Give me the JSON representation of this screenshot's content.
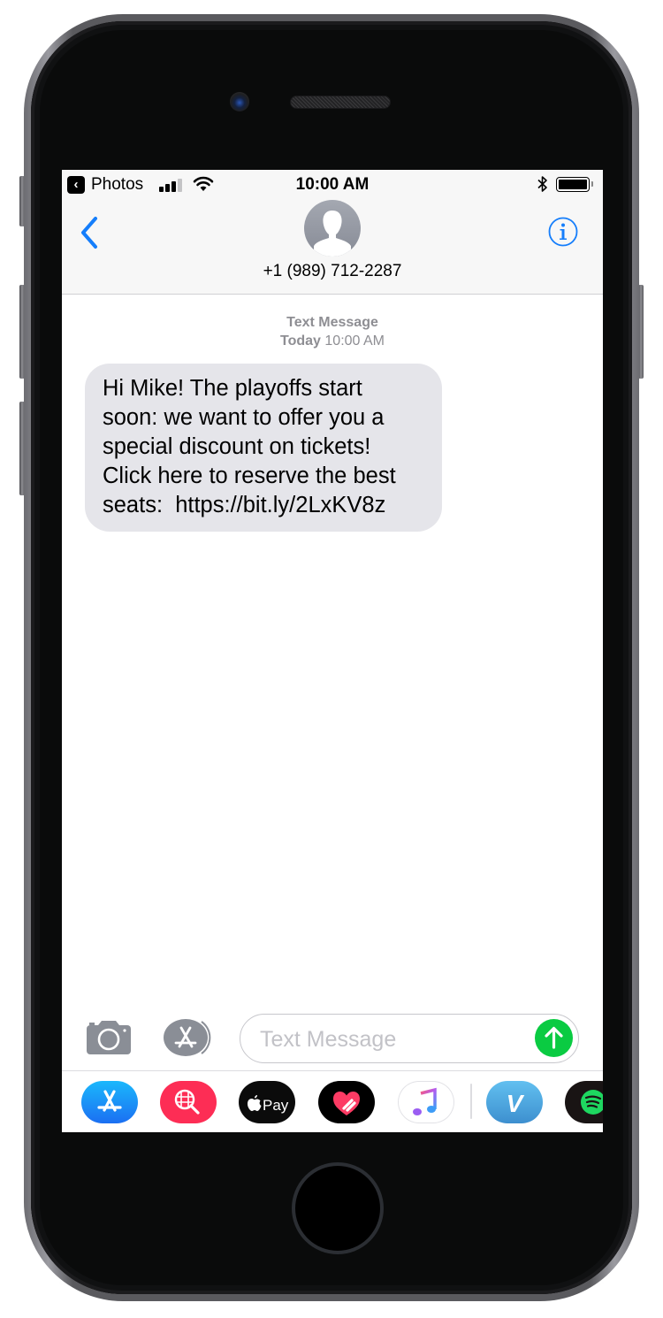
{
  "status_bar": {
    "back_app": "Photos",
    "time": "10:00 AM",
    "signal_bars": 3,
    "signal_max": 4,
    "battery_level": 1.0
  },
  "header": {
    "contact": "+1 (989) 712-2287",
    "back_icon": "chevron-left-icon",
    "info_icon": "info-icon"
  },
  "conversation": {
    "meta_type": "Text Message",
    "meta_day": "Today",
    "meta_time": "10:00 AM",
    "messages": [
      {
        "direction": "incoming",
        "lines": [
          "Hi Mike! The playoffs start",
          "soon: we want to offer you a",
          "special discount on tickets!",
          "Click here to reserve the best",
          "seats:  https://bit.ly/2LxKV8z"
        ]
      }
    ]
  },
  "composer": {
    "placeholder": "Text Message",
    "value": ""
  },
  "app_drawer": {
    "apps": [
      {
        "name": "App Store",
        "icon": "app-store-icon",
        "color": "#1b8cf5"
      },
      {
        "name": "Search Images",
        "icon": "globe-search-icon",
        "color": "#fd2d55"
      },
      {
        "name": "Apple Pay",
        "icon": "apple-pay-icon",
        "color": "#0b0b0b",
        "label": "Pay"
      },
      {
        "name": "Digital Touch",
        "icon": "heart-touch-icon",
        "color": "#000000"
      },
      {
        "name": "Music",
        "icon": "music-note-icon",
        "color": "#ffffff"
      },
      {
        "name": "Venmo",
        "icon": "venmo-icon",
        "color": "#3d95ce",
        "label": "V"
      },
      {
        "name": "Spotify",
        "icon": "spotify-icon",
        "color": "#191414"
      }
    ]
  },
  "colors": {
    "ios_blue": "#157efb",
    "send_green": "#0acb42",
    "bubble_gray": "#e5e5ea",
    "meta_gray": "#8e8e93"
  }
}
